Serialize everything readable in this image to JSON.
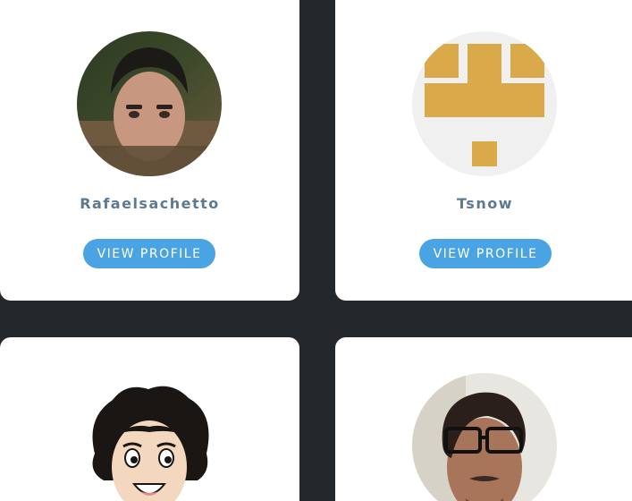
{
  "profiles": [
    {
      "username": "Rafaelsachetto",
      "button_label": "VIEW PROFILE"
    },
    {
      "username": "Tsnow",
      "button_label": "VIEW PROFILE"
    },
    {
      "username": "",
      "button_label": ""
    },
    {
      "username": "",
      "button_label": ""
    }
  ],
  "colors": {
    "background": "#24282d",
    "card": "#ffffff",
    "username_text": "#5d7a93",
    "button": "#4aa3e3",
    "button_text": "#ffffff",
    "identicon_gold": "#d9a94a",
    "identicon_bg": "#f0f0f0"
  }
}
